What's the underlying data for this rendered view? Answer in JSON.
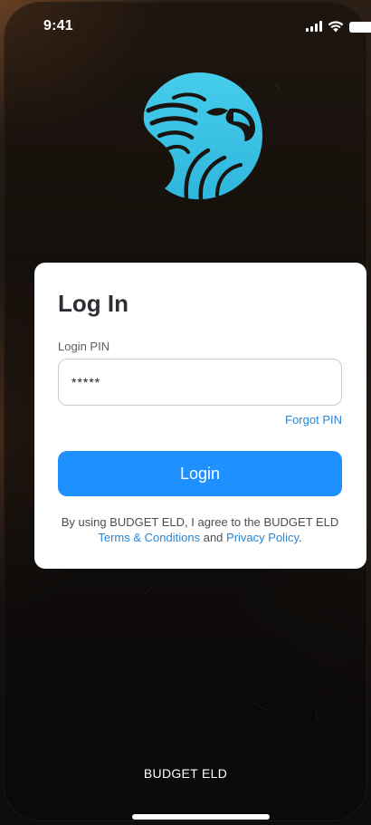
{
  "status_bar": {
    "time": "9:41",
    "icons": [
      "signal-icon",
      "wifi-icon",
      "battery-icon"
    ]
  },
  "logo": {
    "icon": "eagle-logo-icon",
    "color": "#3fc8e8"
  },
  "login_card": {
    "title": "Log In",
    "pin_label": "Login PIN",
    "pin_value": "*****",
    "forgot_pin": "Forgot PIN",
    "login_button": "Login",
    "agreement_prefix": "By using BUDGET ELD, I agree to the BUDGET ELD",
    "terms_link": "Terms & Conditions",
    "agreement_and": "and",
    "privacy_link": "Privacy Policy",
    "agreement_suffix": "."
  },
  "footer": {
    "brand": "BUDGET ELD"
  },
  "colors": {
    "accent": "#1e90ff",
    "link": "#2a86d6",
    "card_bg": "#ffffff",
    "background": "#1a1410"
  }
}
